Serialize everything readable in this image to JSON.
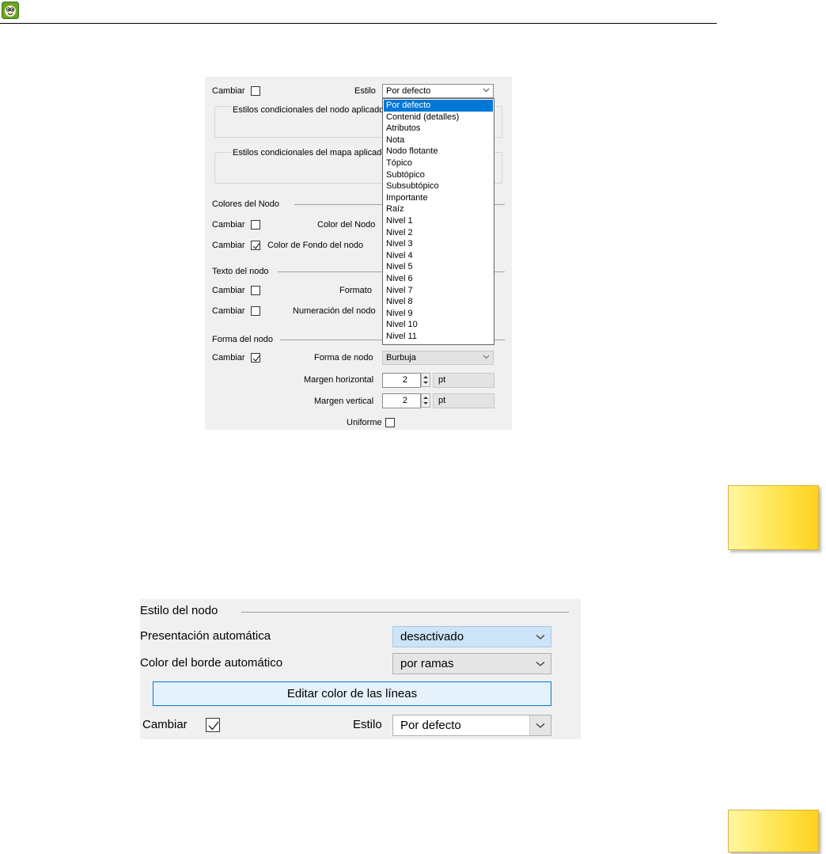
{
  "panel1": {
    "change_label": "Cambiar",
    "style_label": "Estilo",
    "style_value": "Por defecto",
    "node_conditional_styles": "Estilos condicionales del nodo aplicados",
    "map_conditional_styles": "Estilos condicionales del mapa aplicados",
    "section_node_colors": "Colores del Nodo",
    "node_color_label": "Color del Nodo",
    "node_bg_color_label": "Color de Fondo del nodo",
    "section_node_text": "Texto del nodo",
    "format_label": "Formato",
    "numbering_label": "Numeración del nodo",
    "section_node_shape": "Forma del nodo",
    "shape_label": "Forma de nodo",
    "shape_value": "Burbuja",
    "h_margin_label": "Margen horizontal",
    "h_margin_value": "2",
    "v_margin_label": "Margen vertical",
    "v_margin_value": "2",
    "unit": "pt",
    "uniform_label": "Uniforme",
    "checks": {
      "style_change": false,
      "node_color": false,
      "bg_color": true,
      "format": false,
      "numbering": false,
      "shape": true,
      "uniform": false
    }
  },
  "dropdown": {
    "selected_index": 0,
    "options": [
      "Por defecto",
      "Contenid (detalles)",
      "Atributos",
      "Nota",
      "Nodo flotante",
      "Tópico",
      "Subtópico",
      "Subsubtópico",
      "Importante",
      "Raíz",
      "Nivel 1",
      "Nivel 2",
      "Nivel 3",
      "Nivel 4",
      "Nivel 5",
      "Nivel 6",
      "Nivel 7",
      "Nivel 8",
      "Nivel 9",
      "Nivel 10",
      "Nivel 11"
    ]
  },
  "panel2": {
    "section_title": "Estilo del nodo",
    "auto_layout_label": "Presentación automática",
    "auto_layout_value": "desactivado",
    "auto_border_label": "Color del borde automático",
    "auto_border_value": "por ramas",
    "edit_line_color_button": "Editar color de las líneas",
    "change_label": "Cambiar",
    "change_checked": true,
    "style_label": "Estilo",
    "style_value": "Por defecto"
  },
  "colors": {
    "selection": "#0078d7",
    "panel_bg": "#f0f0f0",
    "note_yellow": "#ffe34a"
  }
}
